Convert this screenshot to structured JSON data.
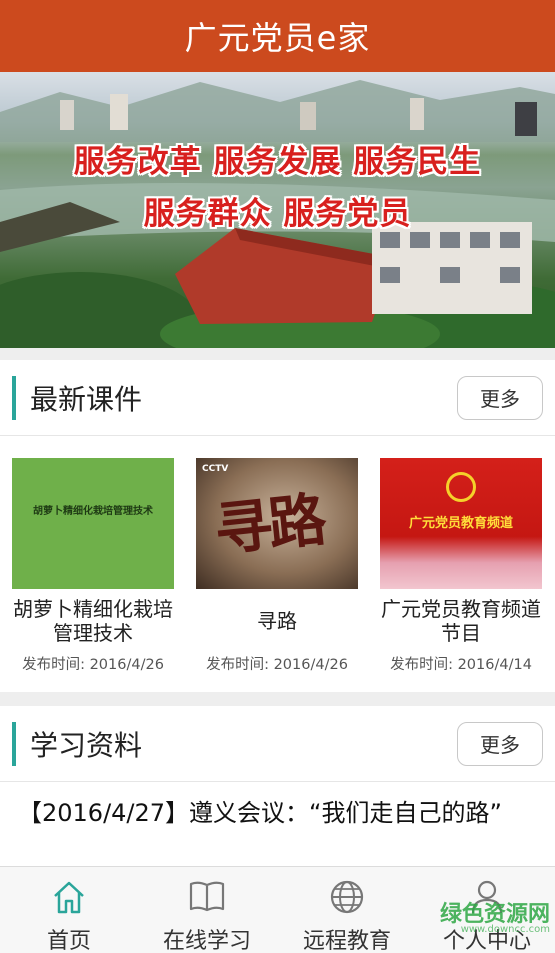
{
  "app": {
    "title": "广元党员e家"
  },
  "banner": {
    "line1": "服务改革 服务发展 服务民生",
    "line2": "服务群众 服务党员"
  },
  "courses_section": {
    "title": "最新课件",
    "more_label": "更多",
    "items": [
      {
        "title": "胡萝卜精细化栽培管理技术",
        "thumb_text": "胡萝卜精细化栽培管理技术",
        "date": "发布时间: 2016/4/26"
      },
      {
        "title": "寻路",
        "thumb_text": "寻路",
        "thumb_logo": "CCTV",
        "date": "发布时间: 2016/4/26"
      },
      {
        "title": "广元党员教育频道节目",
        "thumb_text": "广元党员教育频道",
        "date": "发布时间: 2016/4/14"
      }
    ]
  },
  "study_section": {
    "title": "学习资料",
    "more_label": "更多",
    "items": [
      {
        "text": "【2016/4/27】遵义会议：“我们走自己的路”"
      }
    ]
  },
  "tabbar": {
    "items": [
      {
        "label": "首页",
        "icon": "home-icon",
        "active": true
      },
      {
        "label": "在线学习",
        "icon": "book-icon"
      },
      {
        "label": "远程教育",
        "icon": "globe-icon"
      },
      {
        "label": "个人中心",
        "icon": "user-icon"
      }
    ]
  },
  "watermark": {
    "text": "绿色资源网",
    "sub": "www.downcc.com"
  },
  "colors": {
    "header": "#cc4a1e",
    "accent": "#2aa59a",
    "tab_active": "#2aa59a"
  }
}
